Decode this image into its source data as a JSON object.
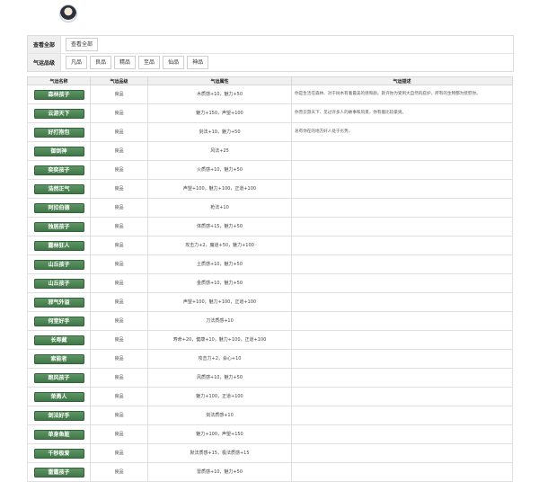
{
  "header": {
    "site_name": "",
    "avatar_icon": "avatar-icon"
  },
  "filters": {
    "row1": {
      "label": "查看全部",
      "options": [
        "查看全部"
      ]
    },
    "row2": {
      "label": "气运品级",
      "options": [
        "凡品",
        "良品",
        "精品",
        "至品",
        "仙品",
        "神品"
      ]
    }
  },
  "table": {
    "headers": [
      "气运名称",
      "气运品级",
      "气运属性",
      "气运描述"
    ],
    "rows": [
      {
        "name": "森林孩子",
        "grade": "良品",
        "attr": "木质感+10，魅力+50",
        "desc": "你是生活在森林、对于树木有着最美的感和颜。就许你为受到大自然的庇护，所有的生物都为抚慰你。"
      },
      {
        "name": "云游天下",
        "grade": "良品",
        "attr": "魅力+150，声望+100",
        "desc": "你曾云游天下、见过许多人的故事和风景，你有着比较豪爽。"
      },
      {
        "name": "好打抱包",
        "grade": "良品",
        "attr": "剑法+10，魅力+50",
        "desc": "总有你在的地方好人处于劣势。"
      },
      {
        "name": "御剑神",
        "grade": "良品",
        "attr": "风法+25",
        "desc": ""
      },
      {
        "name": "奕奕孩子",
        "grade": "良品",
        "attr": "火质感+10，魅力+50",
        "desc": ""
      },
      {
        "name": "浩然正气",
        "grade": "良品",
        "attr": "声望+100，魅力+100，正道+100",
        "desc": ""
      },
      {
        "name": "阿拉伯德",
        "grade": "良品",
        "attr": "枪法+10",
        "desc": ""
      },
      {
        "name": "独居孩子",
        "grade": "良品",
        "attr": "体质感+15，魅力+50",
        "desc": ""
      },
      {
        "name": "露林狂人",
        "grade": "良品",
        "attr": "攻击力+2，魔道+50，魅力+100",
        "desc": ""
      },
      {
        "name": "山丘孩子",
        "grade": "良品",
        "attr": "土质感+10，魅力+50",
        "desc": ""
      },
      {
        "name": "山丘孩子",
        "grade": "良品",
        "attr": "金质感+10，魅力+50",
        "desc": ""
      },
      {
        "name": "邪气外溢",
        "grade": "良品",
        "attr": "声望+100，魅力+100，正道+100",
        "desc": ""
      },
      {
        "name": "何堂好手",
        "grade": "良品",
        "attr": "刀法质感+10",
        "desc": ""
      },
      {
        "name": "长寿藏",
        "grade": "良品",
        "attr": "寿命+20，健康+10，魅力+100，正道+100",
        "desc": ""
      },
      {
        "name": "索能者",
        "grade": "良品",
        "attr": "攻击力+2，会心+10",
        "desc": ""
      },
      {
        "name": "跑风孩子",
        "grade": "良品",
        "attr": "风质感+10，魅力+50",
        "desc": ""
      },
      {
        "name": "荣勇人",
        "grade": "良品",
        "attr": "魅力+100，正道+100",
        "desc": ""
      },
      {
        "name": "剑法好手",
        "grade": "良品",
        "attr": "剑法质感+10",
        "desc": ""
      },
      {
        "name": "单身鱼脏",
        "grade": "良品",
        "attr": "魅力+100，声望+150",
        "desc": ""
      },
      {
        "name": "千秒极爱",
        "grade": "良品",
        "attr": "默法质感+15，极法质感+15",
        "desc": ""
      },
      {
        "name": "雷霆孩子",
        "grade": "良品",
        "attr": "雷质感+10，魅力+50",
        "desc": ""
      }
    ]
  },
  "watermark": ""
}
